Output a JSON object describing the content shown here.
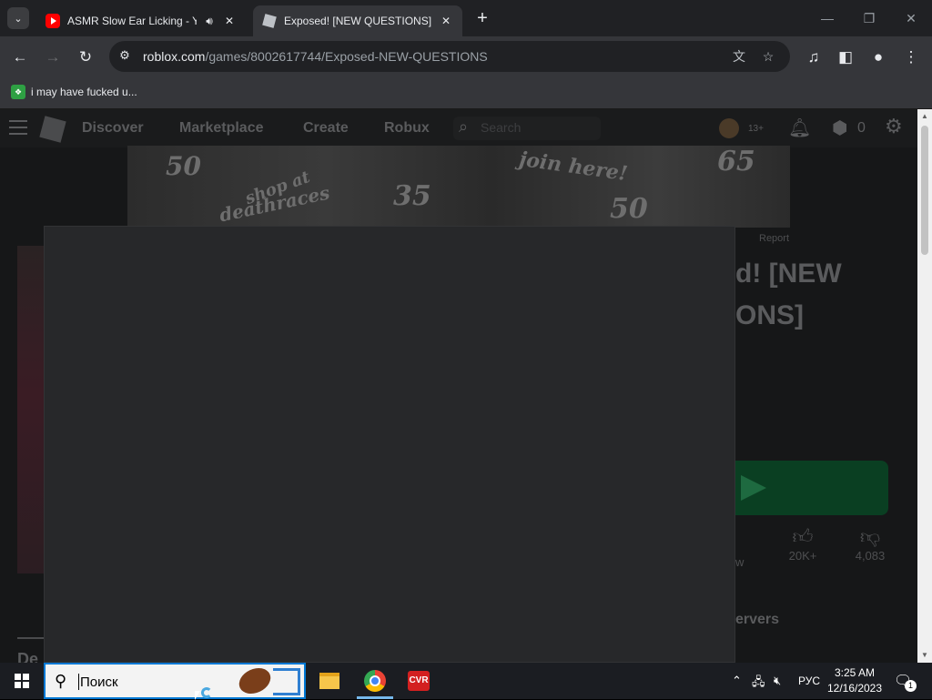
{
  "browser": {
    "tabs": [
      {
        "title": "ASMR Slow Ear Licking - Yo",
        "favicon": "youtube-icon",
        "audio": true,
        "active": false
      },
      {
        "title": "Exposed! [NEW QUESTIONS] - I",
        "favicon": "roblox-icon",
        "audio": false,
        "active": true
      }
    ],
    "url_host": "roblox.com",
    "url_path": "/games/8002617744/Exposed-NEW-QUESTIONS",
    "bookmarks": [
      {
        "label": "i may have fucked u..."
      }
    ]
  },
  "roblox": {
    "nav": {
      "discover": "Discover",
      "marketplace": "Marketplace",
      "create": "Create",
      "robux": "Robux",
      "search_placeholder": "Search",
      "age": "13+",
      "robux_count": "0"
    },
    "ad": {
      "t1": "50",
      "t2": "shop at",
      "t3": "deathraces",
      "t4": "35",
      "t5": "join here!",
      "t6": "65",
      "t7": "50"
    },
    "report": "Report",
    "title_line1": "d! [NEW",
    "title_line2": "ONS]",
    "likes": "20K+",
    "dislikes": "4,083",
    "favorite_partial": "w",
    "servers_partial": "ervers",
    "left_partial": "De"
  },
  "taskbar": {
    "search_text": "Поиск",
    "language": "РУС",
    "time": "3:25 AM",
    "date": "12/16/2023",
    "notification_count": "1"
  },
  "colors": {
    "accent": "#0078d4",
    "play_button": "#0a3f22"
  }
}
